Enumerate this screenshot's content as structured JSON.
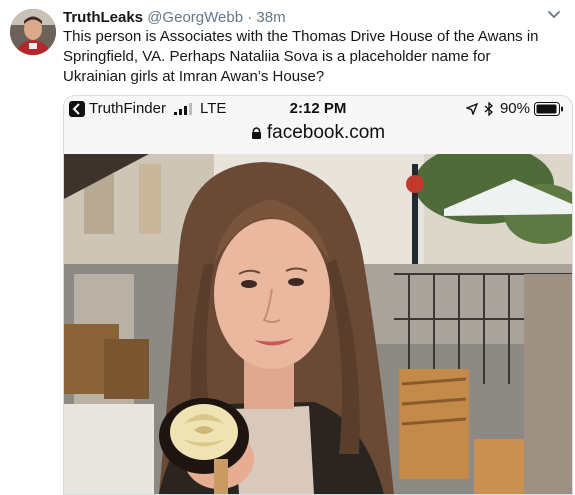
{
  "tweet": {
    "display_name": "TruthLeaks",
    "handle": "@GeorgWebb",
    "separator": "·",
    "time": "38m",
    "text": "This person is Associates with the Thomas Drive House of the Awans in Springfield, VA. Perhaps Nataliia Sova is a placeholder name for Ukrainian girls at Imran Awan’s House?"
  },
  "phone_status": {
    "app_name": "TruthFinder",
    "network": "LTE",
    "clock": "2:12 PM",
    "battery": "90%"
  },
  "browser": {
    "url": "facebook.com"
  },
  "icons": {
    "chevron": "chevron-down-icon",
    "back": "back-arrow-icon",
    "signal": "signal-bars-icon",
    "location": "location-arrow-icon",
    "bluetooth": "bluetooth-icon",
    "battery": "battery-icon",
    "lock": "lock-icon"
  },
  "colors": {
    "name": "#14171a",
    "secondary_text": "#657786",
    "border": "#d8dde1"
  }
}
